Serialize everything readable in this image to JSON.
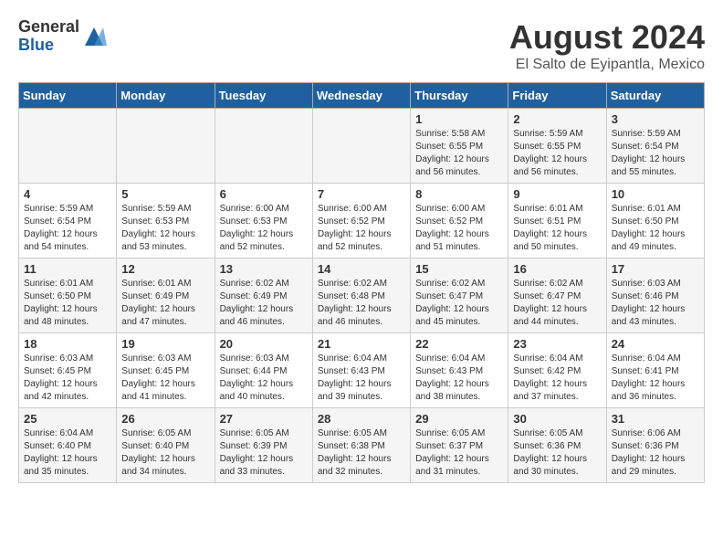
{
  "header": {
    "logo_general": "General",
    "logo_blue": "Blue",
    "month": "August 2024",
    "location": "El Salto de Eyipantla, Mexico"
  },
  "weekdays": [
    "Sunday",
    "Monday",
    "Tuesday",
    "Wednesday",
    "Thursday",
    "Friday",
    "Saturday"
  ],
  "weeks": [
    [
      {
        "day": "",
        "info": ""
      },
      {
        "day": "",
        "info": ""
      },
      {
        "day": "",
        "info": ""
      },
      {
        "day": "",
        "info": ""
      },
      {
        "day": "1",
        "info": "Sunrise: 5:58 AM\nSunset: 6:55 PM\nDaylight: 12 hours\nand 56 minutes."
      },
      {
        "day": "2",
        "info": "Sunrise: 5:59 AM\nSunset: 6:55 PM\nDaylight: 12 hours\nand 56 minutes."
      },
      {
        "day": "3",
        "info": "Sunrise: 5:59 AM\nSunset: 6:54 PM\nDaylight: 12 hours\nand 55 minutes."
      }
    ],
    [
      {
        "day": "4",
        "info": "Sunrise: 5:59 AM\nSunset: 6:54 PM\nDaylight: 12 hours\nand 54 minutes."
      },
      {
        "day": "5",
        "info": "Sunrise: 5:59 AM\nSunset: 6:53 PM\nDaylight: 12 hours\nand 53 minutes."
      },
      {
        "day": "6",
        "info": "Sunrise: 6:00 AM\nSunset: 6:53 PM\nDaylight: 12 hours\nand 52 minutes."
      },
      {
        "day": "7",
        "info": "Sunrise: 6:00 AM\nSunset: 6:52 PM\nDaylight: 12 hours\nand 52 minutes."
      },
      {
        "day": "8",
        "info": "Sunrise: 6:00 AM\nSunset: 6:52 PM\nDaylight: 12 hours\nand 51 minutes."
      },
      {
        "day": "9",
        "info": "Sunrise: 6:01 AM\nSunset: 6:51 PM\nDaylight: 12 hours\nand 50 minutes."
      },
      {
        "day": "10",
        "info": "Sunrise: 6:01 AM\nSunset: 6:50 PM\nDaylight: 12 hours\nand 49 minutes."
      }
    ],
    [
      {
        "day": "11",
        "info": "Sunrise: 6:01 AM\nSunset: 6:50 PM\nDaylight: 12 hours\nand 48 minutes."
      },
      {
        "day": "12",
        "info": "Sunrise: 6:01 AM\nSunset: 6:49 PM\nDaylight: 12 hours\nand 47 minutes."
      },
      {
        "day": "13",
        "info": "Sunrise: 6:02 AM\nSunset: 6:49 PM\nDaylight: 12 hours\nand 46 minutes."
      },
      {
        "day": "14",
        "info": "Sunrise: 6:02 AM\nSunset: 6:48 PM\nDaylight: 12 hours\nand 46 minutes."
      },
      {
        "day": "15",
        "info": "Sunrise: 6:02 AM\nSunset: 6:47 PM\nDaylight: 12 hours\nand 45 minutes."
      },
      {
        "day": "16",
        "info": "Sunrise: 6:02 AM\nSunset: 6:47 PM\nDaylight: 12 hours\nand 44 minutes."
      },
      {
        "day": "17",
        "info": "Sunrise: 6:03 AM\nSunset: 6:46 PM\nDaylight: 12 hours\nand 43 minutes."
      }
    ],
    [
      {
        "day": "18",
        "info": "Sunrise: 6:03 AM\nSunset: 6:45 PM\nDaylight: 12 hours\nand 42 minutes."
      },
      {
        "day": "19",
        "info": "Sunrise: 6:03 AM\nSunset: 6:45 PM\nDaylight: 12 hours\nand 41 minutes."
      },
      {
        "day": "20",
        "info": "Sunrise: 6:03 AM\nSunset: 6:44 PM\nDaylight: 12 hours\nand 40 minutes."
      },
      {
        "day": "21",
        "info": "Sunrise: 6:04 AM\nSunset: 6:43 PM\nDaylight: 12 hours\nand 39 minutes."
      },
      {
        "day": "22",
        "info": "Sunrise: 6:04 AM\nSunset: 6:43 PM\nDaylight: 12 hours\nand 38 minutes."
      },
      {
        "day": "23",
        "info": "Sunrise: 6:04 AM\nSunset: 6:42 PM\nDaylight: 12 hours\nand 37 minutes."
      },
      {
        "day": "24",
        "info": "Sunrise: 6:04 AM\nSunset: 6:41 PM\nDaylight: 12 hours\nand 36 minutes."
      }
    ],
    [
      {
        "day": "25",
        "info": "Sunrise: 6:04 AM\nSunset: 6:40 PM\nDaylight: 12 hours\nand 35 minutes."
      },
      {
        "day": "26",
        "info": "Sunrise: 6:05 AM\nSunset: 6:40 PM\nDaylight: 12 hours\nand 34 minutes."
      },
      {
        "day": "27",
        "info": "Sunrise: 6:05 AM\nSunset: 6:39 PM\nDaylight: 12 hours\nand 33 minutes."
      },
      {
        "day": "28",
        "info": "Sunrise: 6:05 AM\nSunset: 6:38 PM\nDaylight: 12 hours\nand 32 minutes."
      },
      {
        "day": "29",
        "info": "Sunrise: 6:05 AM\nSunset: 6:37 PM\nDaylight: 12 hours\nand 31 minutes."
      },
      {
        "day": "30",
        "info": "Sunrise: 6:05 AM\nSunset: 6:36 PM\nDaylight: 12 hours\nand 30 minutes."
      },
      {
        "day": "31",
        "info": "Sunrise: 6:06 AM\nSunset: 6:36 PM\nDaylight: 12 hours\nand 29 minutes."
      }
    ]
  ]
}
